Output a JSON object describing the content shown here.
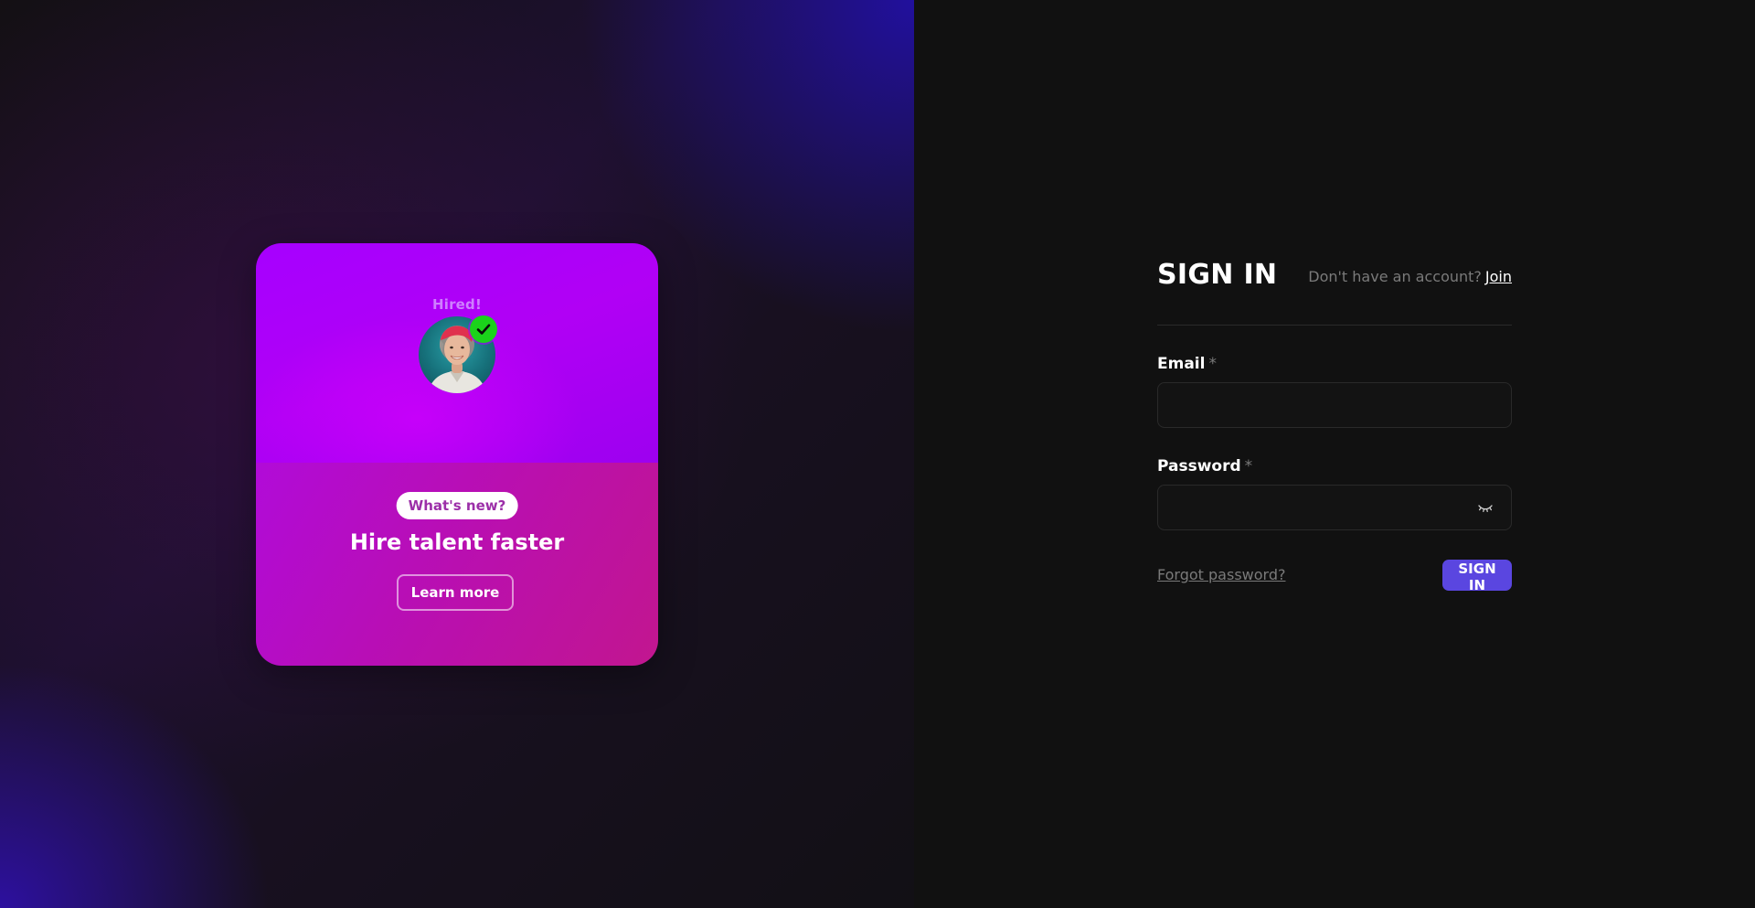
{
  "promo": {
    "hired_label": "Hired!",
    "badge": "What's new?",
    "title": "Hire talent faster",
    "cta_label": "Learn more"
  },
  "signin": {
    "title": "SIGN IN",
    "no_account_text": "Don't have an account?",
    "join_label": "Join",
    "email": {
      "label": "Email",
      "required_mark": "*",
      "value": "",
      "placeholder": ""
    },
    "password": {
      "label": "Password",
      "required_mark": "*",
      "value": "",
      "placeholder": ""
    },
    "forgot_label": "Forgot password?",
    "submit_label": "SIGN IN"
  },
  "icons": {
    "avatar": "avatar-photo",
    "check": "check-icon",
    "eye": "eye-closed-icon"
  },
  "colors": {
    "page_background": "#111111",
    "card_top": "#a600ff",
    "card_bottom": "#b90fb0",
    "check_badge": "#1bd31b",
    "primary_button": "#5a46e0",
    "muted_text": "#7a7a7a"
  }
}
